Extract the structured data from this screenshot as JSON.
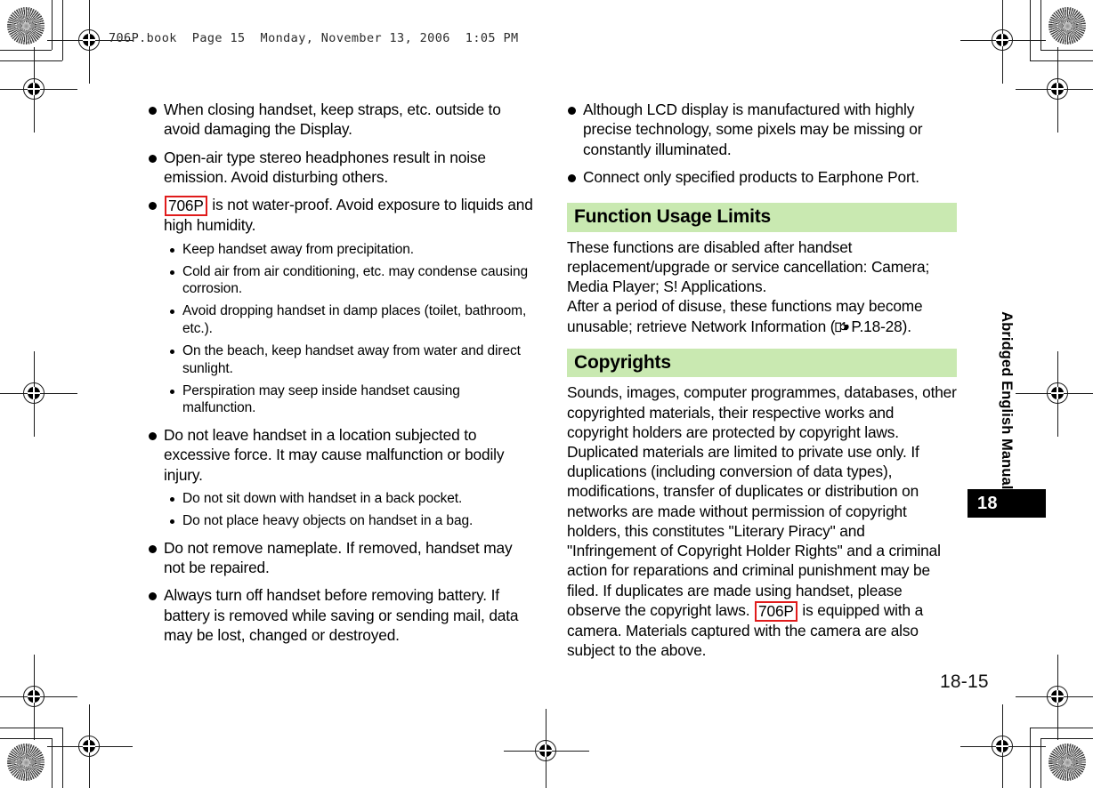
{
  "file_header": "706P.book  Page 15  Monday, November 13, 2006  1:05 PM",
  "theme": {
    "section_heading_bg": "#c9e9b1",
    "model_tag_border": "#e01b1b",
    "chapter_tab_bg": "#000000",
    "text_color": "#000000"
  },
  "left_column": {
    "bullets": [
      {
        "text": "When closing handset, keep straps, etc. outside to avoid damaging the Display."
      },
      {
        "text": "Open-air type stereo headphones result in noise emission. Avoid disturbing others."
      },
      {
        "tag": "706P",
        "text": " is not water-proof. Avoid exposure to liquids and high humidity.",
        "sub": [
          "Keep handset away from precipitation.",
          "Cold air from air conditioning, etc. may condense causing corrosion.",
          "Avoid dropping handset in damp places (toilet, bathroom, etc.).",
          "On the beach, keep handset away from water and direct sunlight.",
          "Perspiration may seep inside handset causing malfunction."
        ]
      },
      {
        "text": "Do not leave handset in a location subjected to excessive force. It may cause malfunction or bodily injury.",
        "sub": [
          "Do not sit down with handset in a back pocket.",
          "Do not place heavy objects on handset in a bag."
        ]
      },
      {
        "text": "Do not remove nameplate. If removed, handset may not be repaired."
      },
      {
        "text": "Always turn off handset before removing battery. If battery is removed while saving or sending mail, data may be lost, changed or destroyed."
      }
    ]
  },
  "right_column": {
    "bullets": [
      {
        "text": "Although LCD display is manufactured with highly precise technology, some pixels may be missing or constantly illuminated."
      },
      {
        "text": "Connect only specified products to Earphone Port."
      }
    ],
    "sections": [
      {
        "heading": "Function Usage Limits",
        "paragraphs": [
          "These functions are disabled after handset replacement/upgrade or service cancellation: Camera; Media Player; S! Applications.",
          "After a period of disuse, these functions may become unusable; retrieve Network Information ("
        ],
        "reference_icon": "pointing-hand-icon",
        "reference_page": "P.18-28",
        "paragraph_tail": ")."
      },
      {
        "heading": "Copyrights",
        "text_before_tag": "Sounds, images, computer programmes, databases, other copyrighted materials, their respective works and copyright holders are protected by copyright laws. Duplicated materials are limited to private use only. If duplications (including conversion of data types), modifications, transfer of duplicates or distribution on networks are made without permission of copyright holders, this constitutes \"Literary Piracy\" and \"Infringement of Copyright Holder Rights\" and a criminal action for reparations and criminal punishment may be filed. If duplicates are made using handset, please observe the copyright laws. ",
        "tag": "706P",
        "text_after_tag": " is equipped with a camera. Materials captured with the camera are also subject to the above."
      }
    ]
  },
  "sidebar": {
    "title": "Abridged English Manual",
    "chapter_number": "18"
  },
  "folio": "18-15"
}
